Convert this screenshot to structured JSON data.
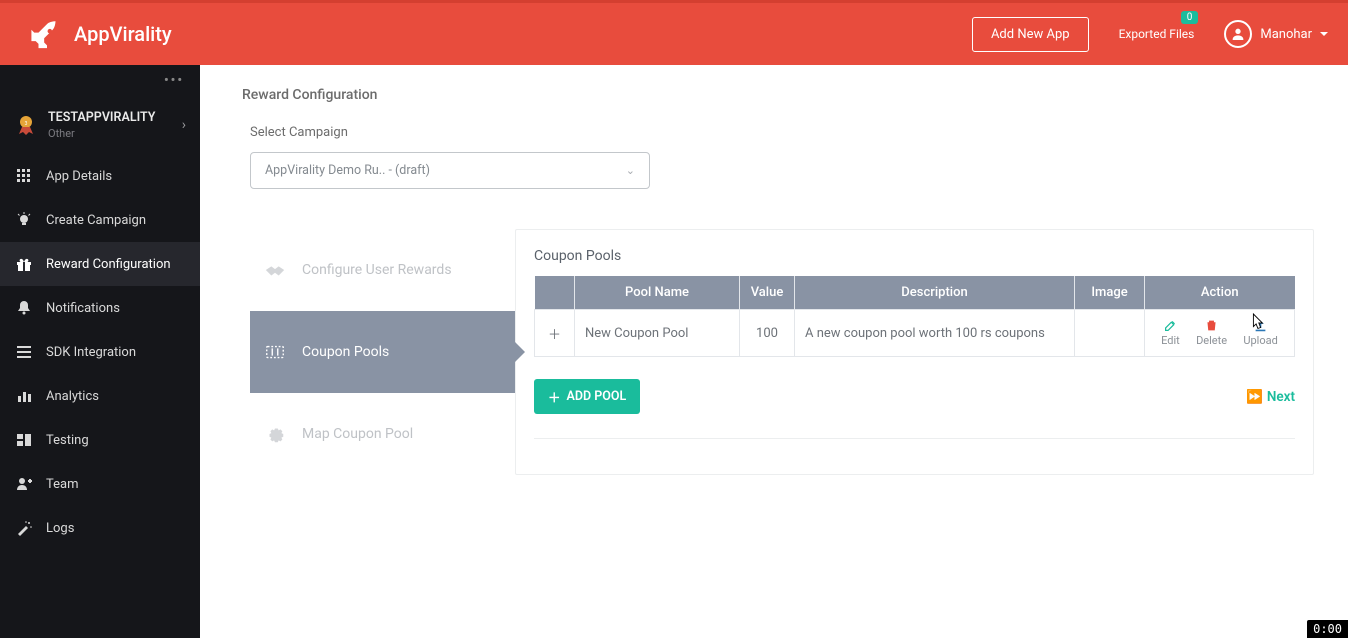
{
  "brand": {
    "name": "AppVirality"
  },
  "topbar": {
    "add_app": "Add New App",
    "exported_files": "Exported Files",
    "exported_badge": "0",
    "user_name": "Manohar"
  },
  "sidebar": {
    "app_name": "TESTAPPVIRALITY",
    "app_sub": "Other",
    "items": {
      "app_details": "App Details",
      "create_campaign": "Create Campaign",
      "reward_config": "Reward Configuration",
      "notifications": "Notifications",
      "sdk_integration": "SDK Integration",
      "analytics": "Analytics",
      "testing": "Testing",
      "team": "Team",
      "logs": "Logs"
    }
  },
  "page": {
    "title": "Reward Configuration",
    "campaign_label": "Select Campaign",
    "campaign_selected": "AppVirality Demo Ru.. - (draft)"
  },
  "steps": {
    "configure": "Configure User Rewards",
    "coupon_pools": "Coupon Pools",
    "map_pool": "Map Coupon Pool"
  },
  "panel": {
    "title": "Coupon Pools",
    "headers": {
      "pool_name": "Pool Name",
      "value": "Value",
      "description": "Description",
      "image": "Image",
      "action": "Action"
    },
    "row": {
      "name": "New Coupon Pool",
      "value": "100",
      "desc": "A new coupon pool worth 100 rs coupons"
    },
    "actions": {
      "edit": "Edit",
      "delete": "Delete",
      "upload": "Upload"
    },
    "add_pool": "ADD POOL",
    "next": "Next"
  },
  "time_badge": "0:00"
}
